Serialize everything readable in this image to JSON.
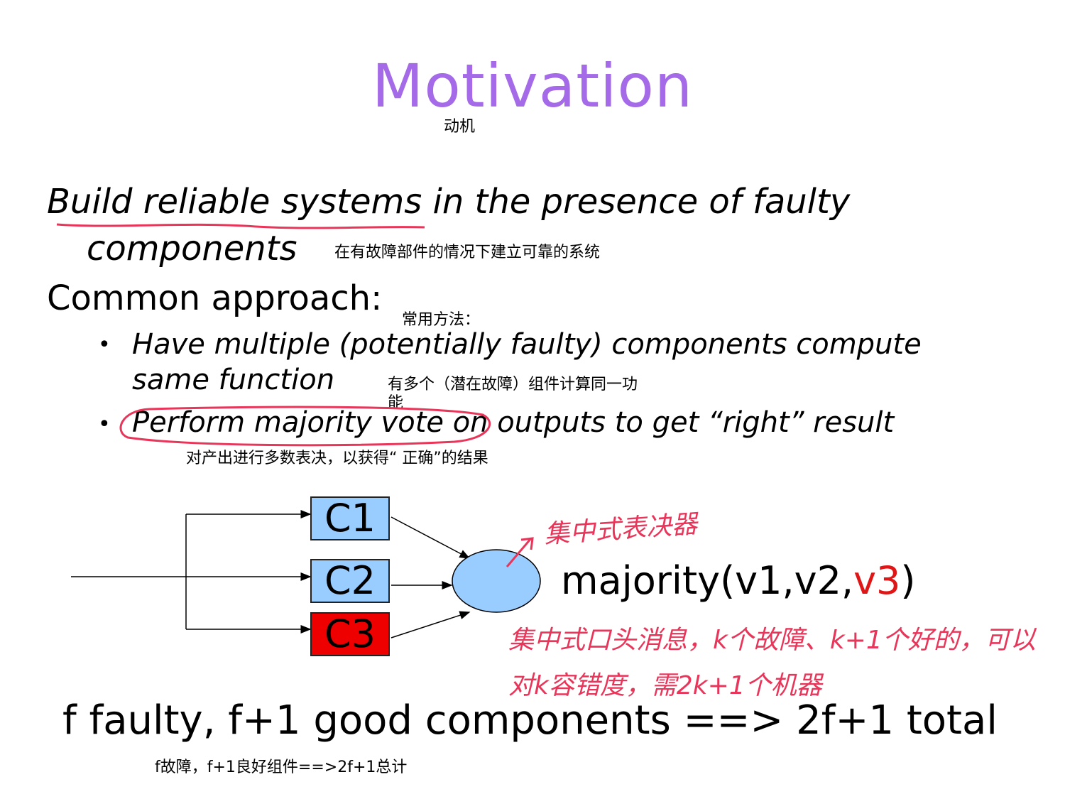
{
  "slide": {
    "title": "Motivation",
    "title_cn": "动机",
    "goal_line1": "Build reliable systems in the presence of faulty",
    "goal_line2": "components",
    "goal_cn": "在有故障部件的情况下建立可靠的系统",
    "approach_heading": "Common approach:",
    "approach_cn": "常用方法：",
    "bullets": [
      {
        "line1": "Have multiple (potentially faulty) components compute",
        "line2": "same function",
        "cn_line1": "有多个（潜在故障）组件计算同一功",
        "cn_line2": "能"
      },
      {
        "line1": "Perform majority vote on outputs to get “right” result",
        "cn": "对产出进行多数表决，以获得“ 正确”的结果"
      }
    ],
    "bullet_symbol": "•",
    "summary": "f faulty, f+1 good components ==> 2f+1 total",
    "summary_cn": "f故障，f+1良好组件==>2f+1总计"
  },
  "diagram": {
    "components": [
      {
        "label": "C1",
        "color": "#99ccff"
      },
      {
        "label": "C2",
        "color": "#99ccff"
      },
      {
        "label": "C3",
        "color": "#ee0000"
      }
    ],
    "voter_color": "#99ccff",
    "majority_prefix": "majority(v1,v2,",
    "majority_faulty": "v3",
    "majority_suffix": ")",
    "faulty_color": "#e01515"
  },
  "annotations": {
    "color": "#e8365a",
    "voter_note": "集中式表决器",
    "note_line1": "集中式口头消息，k个故障、k+1个好的，可以",
    "note_line2": "对k容错度，需2k+1个机器"
  }
}
